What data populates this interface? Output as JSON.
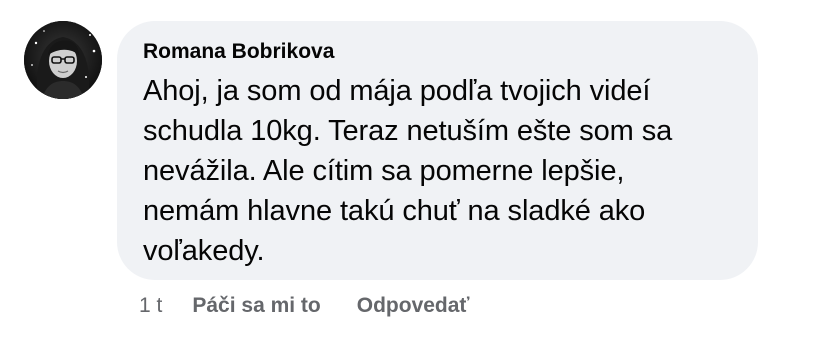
{
  "comment": {
    "author": "Romana Bobrikova",
    "text_lines": [
      "Ahoj, ja som od mája podľa tvojich videí",
      "schudla 10kg. Teraz netuším ešte som sa",
      "nevážila. Ale cítim sa pomerne lepšie,",
      "nemám hlavne takú chuť na sladké ako",
      "voľakedy."
    ],
    "time": "1 t",
    "like_label": "Páči sa mi to",
    "reply_label": "Odpovedať"
  },
  "colors": {
    "bubble_background": "#f0f2f5",
    "text": "#050505",
    "secondary_text": "#65676b"
  },
  "icons": {
    "avatar": "profile-photo-avatar"
  }
}
